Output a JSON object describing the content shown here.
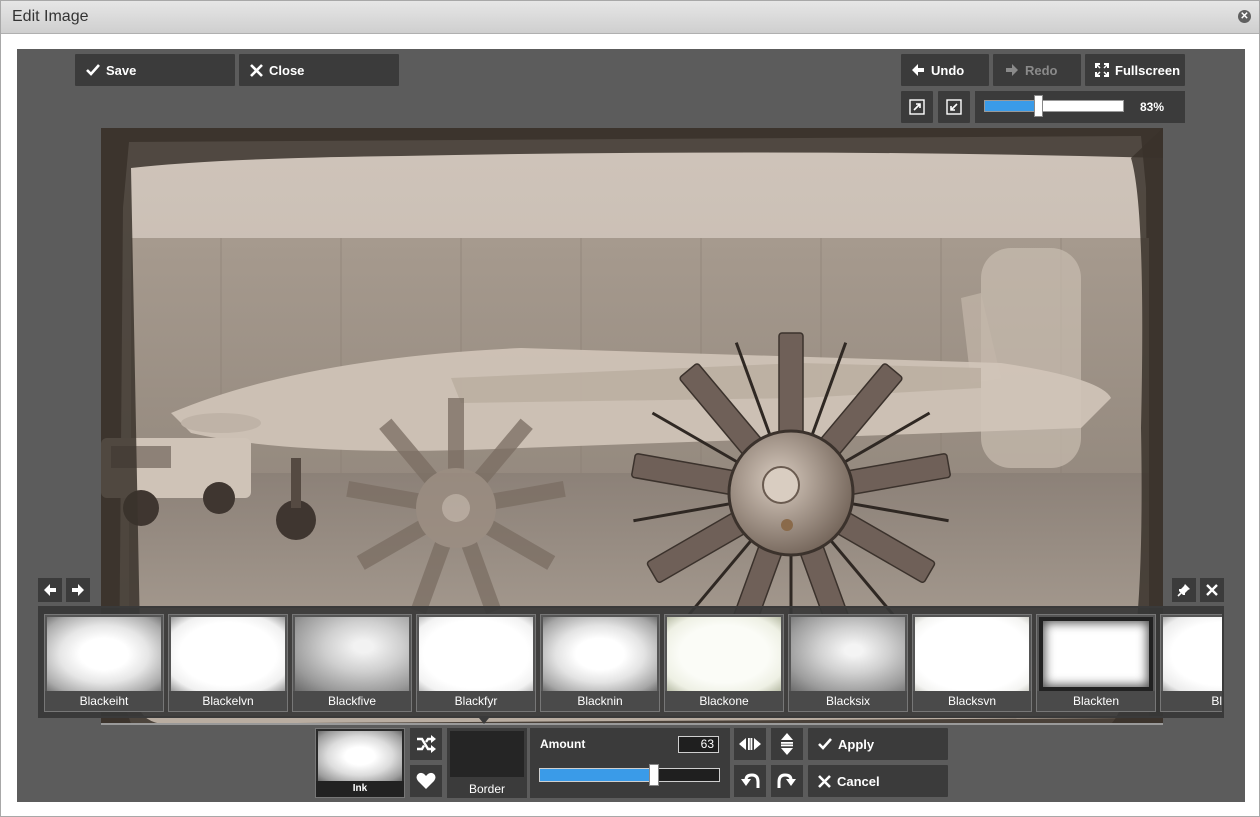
{
  "window": {
    "title": "Edit Image"
  },
  "toolbar": {
    "save_label": "Save",
    "close_label": "Close",
    "undo_label": "Undo",
    "redo_label": "Redo",
    "fullscreen_label": "Fullscreen"
  },
  "zoom": {
    "percent_label": "83%",
    "fraction": 0.42
  },
  "filters": {
    "items": [
      {
        "label": "Blackeiht"
      },
      {
        "label": "Blackelvn"
      },
      {
        "label": "Blackfive"
      },
      {
        "label": "Blackfyr"
      },
      {
        "label": "Blacknin"
      },
      {
        "label": "Blackone"
      },
      {
        "label": "Blacksix"
      },
      {
        "label": "Blacksvn"
      },
      {
        "label": "Blackten"
      },
      {
        "label": "Bla"
      }
    ]
  },
  "panel": {
    "selected_label": "Ink",
    "border_label": "Border",
    "amount_label": "Amount",
    "amount_value": "63",
    "amount_fraction": 0.63,
    "apply_label": "Apply",
    "cancel_label": "Cancel"
  },
  "colors": {
    "accent": "#3a9be8",
    "panel": "#3b3b3b",
    "editor_bg": "#5c5c5c"
  }
}
